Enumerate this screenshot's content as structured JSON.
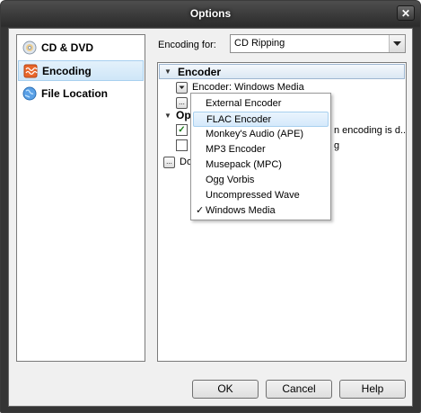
{
  "window": {
    "title": "Options",
    "close_symbol": "✕"
  },
  "nav": {
    "items": [
      {
        "label": "CD & DVD",
        "icon": "cd-icon",
        "selected": false
      },
      {
        "label": "Encoding",
        "icon": "encoding-icon",
        "selected": true
      },
      {
        "label": "File Location",
        "icon": "file-location-icon",
        "selected": false
      }
    ]
  },
  "encoding": {
    "label": "Encoding for:",
    "value": "CD Ripping"
  },
  "panel": {
    "encoder_section": "Encoder",
    "encoder_row": "Encoder: Windows Media",
    "options_section_partial": "Opti",
    "option1_partial": "n encoding is d...",
    "option2_partial": "g",
    "do_partial": "Do"
  },
  "dropdown": {
    "items": [
      {
        "label": "External Encoder",
        "checked": false,
        "hover": false
      },
      {
        "label": "FLAC Encoder",
        "checked": false,
        "hover": true
      },
      {
        "label": "Monkey's Audio (APE)",
        "checked": false,
        "hover": false
      },
      {
        "label": "MP3 Encoder",
        "checked": false,
        "hover": false
      },
      {
        "label": "Musepack (MPC)",
        "checked": false,
        "hover": false
      },
      {
        "label": "Ogg Vorbis",
        "checked": false,
        "hover": false
      },
      {
        "label": "Uncompressed Wave",
        "checked": false,
        "hover": false
      },
      {
        "label": "Windows Media",
        "checked": true,
        "hover": false
      }
    ],
    "check_symbol": "✓"
  },
  "buttons": {
    "ok": "OK",
    "cancel": "Cancel",
    "help": "Help"
  },
  "colors": {
    "selection_bg": "#cfe6f8",
    "title_bar": "#2c2c2c",
    "checkbox_check": "#1a7a1a"
  }
}
